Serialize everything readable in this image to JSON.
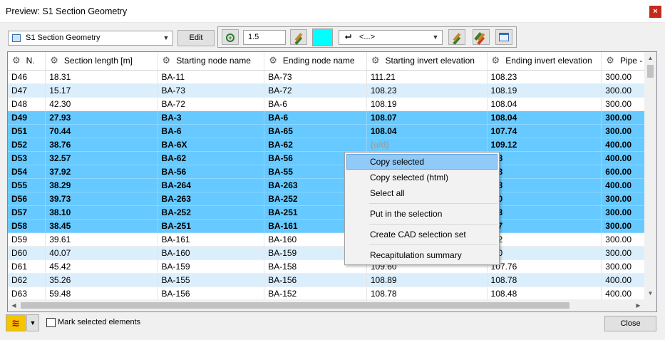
{
  "window": {
    "title": "Preview: S1 Section Geometry",
    "close_glyph": "×"
  },
  "toolbar": {
    "view_select_value": "S1 Section Geometry",
    "edit_label": "Edit",
    "zoom_icon": "zoom-in-icon",
    "scale_value": "1.5",
    "color_swatch": "#00ffff",
    "line_style_value": "<...>"
  },
  "table": {
    "columns": [
      "N.",
      "Section length [m]",
      "Starting node name",
      "Ending node name",
      "Starting invert elevation",
      "Ending invert elevation",
      "Pipe -"
    ],
    "rows": [
      {
        "n": "D46",
        "len": "18.31",
        "start": "BA-11",
        "end": "BA-73",
        "sinv": "111.21",
        "einv": "108.23",
        "pipe": "300.00",
        "state": "normal"
      },
      {
        "n": "D47",
        "len": "15.17",
        "start": "BA-73",
        "end": "BA-72",
        "sinv": "108.23",
        "einv": "108.19",
        "pipe": "300.00",
        "state": "alt"
      },
      {
        "n": "D48",
        "len": "42.30",
        "start": "BA-72",
        "end": "BA-6",
        "sinv": "108.19",
        "einv": "108.04",
        "pipe": "300.00",
        "state": "normal"
      },
      {
        "n": "D49",
        "len": "27.93",
        "start": "BA-3",
        "end": "BA-6",
        "sinv": "108.07",
        "einv": "108.04",
        "pipe": "300.00",
        "state": "sel"
      },
      {
        "n": "D51",
        "len": "70.44",
        "start": "BA-6",
        "end": "BA-65",
        "sinv": "108.04",
        "einv": "107.74",
        "pipe": "300.00",
        "state": "sel"
      },
      {
        "n": "D52",
        "len": "38.76",
        "start": "BA-6X",
        "end": "BA-62",
        "sinv": "(u/d)",
        "einv": "109.12",
        "pipe": "400.00",
        "state": "sel"
      },
      {
        "n": "D53",
        "len": "32.57",
        "start": "BA-62",
        "end": "BA-56",
        "sinv": "",
        "einv": ".58",
        "pipe": "400.00",
        "state": "sel"
      },
      {
        "n": "D54",
        "len": "37.92",
        "start": "BA-56",
        "end": "BA-55",
        "sinv": "",
        "einv": ".98",
        "pipe": "600.00",
        "state": "sel"
      },
      {
        "n": "D55",
        "len": "38.29",
        "start": "BA-264",
        "end": "BA-263",
        "sinv": "",
        "einv": ".58",
        "pipe": "400.00",
        "state": "sel"
      },
      {
        "n": "D56",
        "len": "39.73",
        "start": "BA-263",
        "end": "BA-252",
        "sinv": "",
        "einv": ".00",
        "pipe": "300.00",
        "state": "sel"
      },
      {
        "n": "D57",
        "len": "38.10",
        "start": "BA-252",
        "end": "BA-251",
        "sinv": "",
        "einv": ".03",
        "pipe": "300.00",
        "state": "sel"
      },
      {
        "n": "D58",
        "len": "38.45",
        "start": "BA-251",
        "end": "BA-161",
        "sinv": "",
        "einv": ".07",
        "pipe": "300.00",
        "state": "sel"
      },
      {
        "n": "D59",
        "len": "39.61",
        "start": "BA-161",
        "end": "BA-160",
        "sinv": "",
        "einv": ".22",
        "pipe": "300.00",
        "state": "normal"
      },
      {
        "n": "D60",
        "len": "40.07",
        "start": "BA-160",
        "end": "BA-159",
        "sinv": "",
        "einv": ".60",
        "pipe": "300.00",
        "state": "alt"
      },
      {
        "n": "D61",
        "len": "45.42",
        "start": "BA-159",
        "end": "BA-158",
        "sinv": "109.60",
        "einv": "107.76",
        "pipe": "300.00",
        "state": "normal"
      },
      {
        "n": "D62",
        "len": "35.26",
        "start": "BA-155",
        "end": "BA-156",
        "sinv": "108.89",
        "einv": "108.78",
        "pipe": "400.00",
        "state": "alt"
      },
      {
        "n": "D63",
        "len": "59.48",
        "start": "BA-156",
        "end": "BA-152",
        "sinv": "108.78",
        "einv": "108.48",
        "pipe": "400.00",
        "state": "normal"
      }
    ]
  },
  "context_menu": {
    "items": [
      "Copy selected",
      "Copy selected (html)",
      "Select all",
      "Put in the selection",
      "Create CAD selection set",
      "Recapitulation summary"
    ],
    "hovered_index": 0
  },
  "footer": {
    "mark_label": "Mark selected elements",
    "mark_checked": false,
    "close_label": "Close"
  }
}
